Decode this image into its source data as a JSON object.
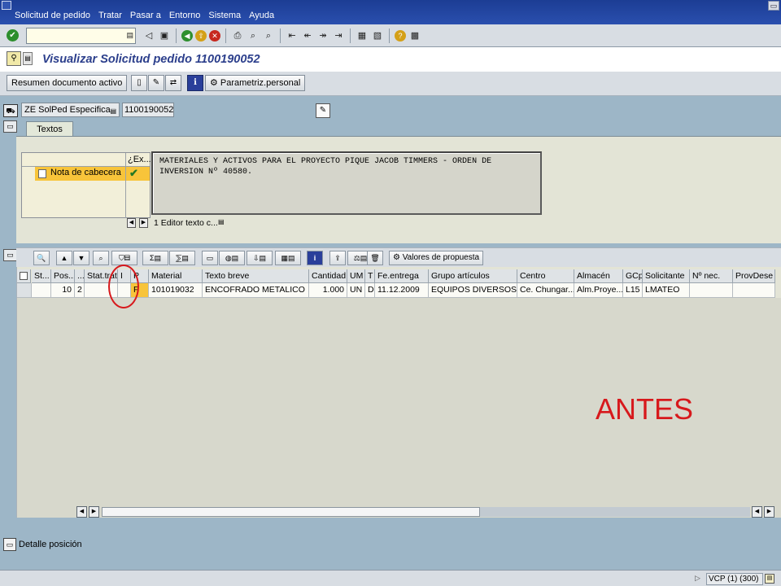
{
  "menu": {
    "items": [
      "Solicitud de pedido",
      "Tratar",
      "Pasar a",
      "Entorno",
      "Sistema",
      "Ayuda"
    ]
  },
  "title": "Visualizar Solicitud pedido 1100190052",
  "app_toolbar": {
    "resumen_label": "Resumen documento activo",
    "param_label": "Parametriz.personal"
  },
  "header": {
    "doc_type": "ZE SolPed Especifica",
    "doc_number": "1100190052"
  },
  "tabs": [
    {
      "label": "Textos"
    }
  ],
  "texts": {
    "tree_header": "¿Ex...",
    "tree_item": "Nota de cabecera",
    "content": "MATERIALES Y ACTIVOS PARA EL PROYECTO PIQUE JACOB TIMMERS - ORDEN DE\nINVERSION Nº 40580.",
    "editor_label": "1 Editor texto c..."
  },
  "grid_toolbar": {
    "valores_label": "Valores de propuesta"
  },
  "grid": {
    "columns": [
      "St...",
      "Pos...",
      "...",
      "Stat.trat.",
      "I",
      "P",
      "Material",
      "Texto breve",
      "Cantidad",
      "UM",
      "T",
      "Fe.entrega",
      "Grupo artículos",
      "Centro",
      "Almacén",
      "GCp",
      "Solicitante",
      "Nº nec.",
      "ProvDese"
    ],
    "rows": [
      [
        "",
        "10",
        "2",
        "",
        "",
        "F",
        "101019032",
        "ENCOFRADO METALICO",
        "1.000",
        "UN",
        "D",
        "11.12.2009",
        "EQUIPOS DIVERSOS",
        "Ce. Chungar...",
        "Alm.Proye...",
        "L15",
        "LMATEO",
        "",
        ""
      ]
    ]
  },
  "annotation": "ANTES",
  "detail_label": "Detalle posición",
  "status": {
    "system": "VCP (1) (300)"
  },
  "colors": {
    "menubar": "#1c3d94",
    "background": "#9db6c7",
    "highlight": "#f8c43a",
    "annotation": "#d7191c",
    "title": "#2c3f8c"
  }
}
